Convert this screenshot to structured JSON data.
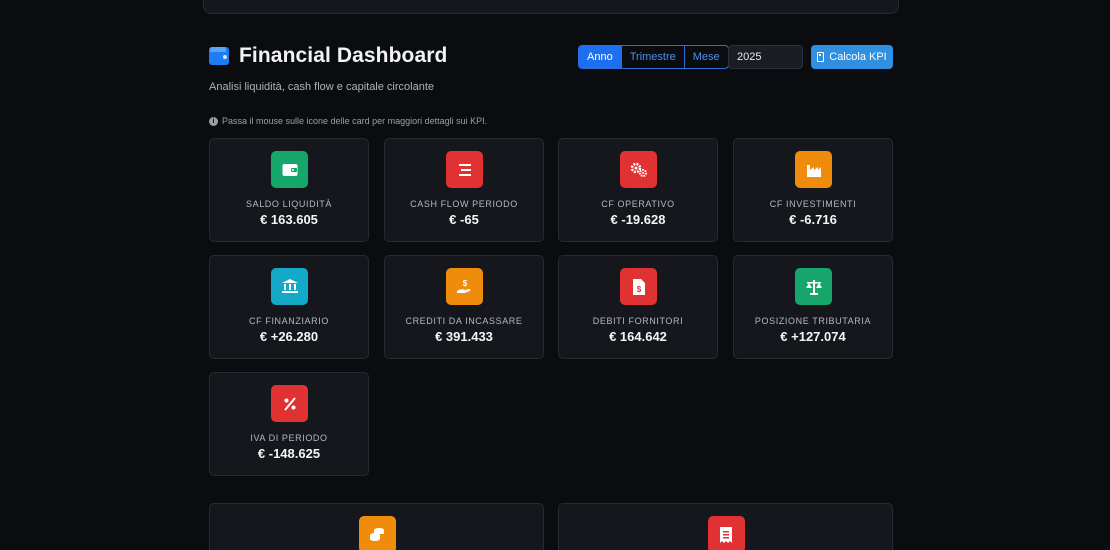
{
  "header": {
    "title": "Financial Dashboard",
    "subtitle": "Analisi liquidità, cash flow e capitale circolante"
  },
  "controls": {
    "periods": [
      "Anno",
      "Trimestre",
      "Mese"
    ],
    "active_period": "Anno",
    "year_value": "2025",
    "calc_label": "Calcola KPI"
  },
  "info_text": "Passa il mouse sulle icone delle card per maggiori dettagli sui KPI.",
  "colors": {
    "accent": "#1c6ff0",
    "green": "#16a66b",
    "red": "#e03232",
    "orange": "#f08c0c",
    "cyan": "#14a9c8"
  },
  "cards": [
    {
      "label": "SALDO LIQUIDITÀ",
      "value": "€ 163.605",
      "icon": "wallet-icon",
      "color": "green"
    },
    {
      "label": "CASH FLOW PERIODO",
      "value": "€ -65",
      "icon": "list-icon",
      "color": "red"
    },
    {
      "label": "CF OPERATIVO",
      "value": "€ -19.628",
      "icon": "gears-icon",
      "color": "red"
    },
    {
      "label": "CF INVESTIMENTI",
      "value": "€ -6.716",
      "icon": "industry-icon",
      "color": "orange"
    },
    {
      "label": "CF FINANZIARIO",
      "value": "€ +26.280",
      "icon": "bank-icon",
      "color": "cyan"
    },
    {
      "label": "CREDITI DA INCASSARE",
      "value": "€ 391.433",
      "icon": "hand-dollar-icon",
      "color": "orange"
    },
    {
      "label": "DEBITI FORNITORI",
      "value": "€ 164.642",
      "icon": "invoice-dollar-icon",
      "color": "red"
    },
    {
      "label": "POSIZIONE TRIBUTARIA",
      "value": "€ +127.074",
      "icon": "scale-icon",
      "color": "green"
    },
    {
      "label": "IVA DI PERIODO",
      "value": "€ -148.625",
      "icon": "percent-icon",
      "color": "red"
    }
  ],
  "bottom_cards": [
    {
      "icon": "coins-icon",
      "color": "orange"
    },
    {
      "icon": "receipt-icon",
      "color": "red"
    }
  ]
}
